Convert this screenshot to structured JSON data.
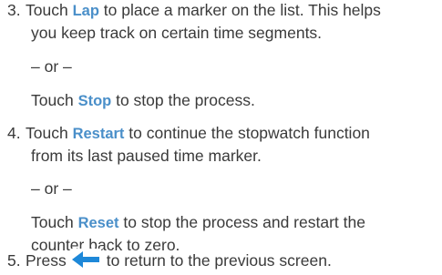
{
  "steps": {
    "s3": {
      "number": "3.",
      "pre": "Touch ",
      "kw": "Lap",
      "post": " to place a marker on the list. This helps",
      "line2": "you keep track on certain time segments."
    },
    "or1": "– or –",
    "s3b": {
      "pre": "Touch ",
      "kw": "Stop",
      "post": " to stop the process."
    },
    "s4": {
      "number": "4.",
      "pre": "Touch ",
      "kw": "Restart",
      "post": " to continue the stopwatch function",
      "line2": "from its last paused time marker."
    },
    "or2": "– or –",
    "s4b": {
      "pre": "Touch ",
      "kw": "Reset",
      "post": " to stop the process and restart the",
      "line2": "counter back to zero."
    },
    "s5": {
      "number": "5.",
      "pre": "Press",
      "post": "to return to the previous screen.",
      "icon": "back-arrow-icon",
      "icon_color": "#1e88d8"
    }
  }
}
